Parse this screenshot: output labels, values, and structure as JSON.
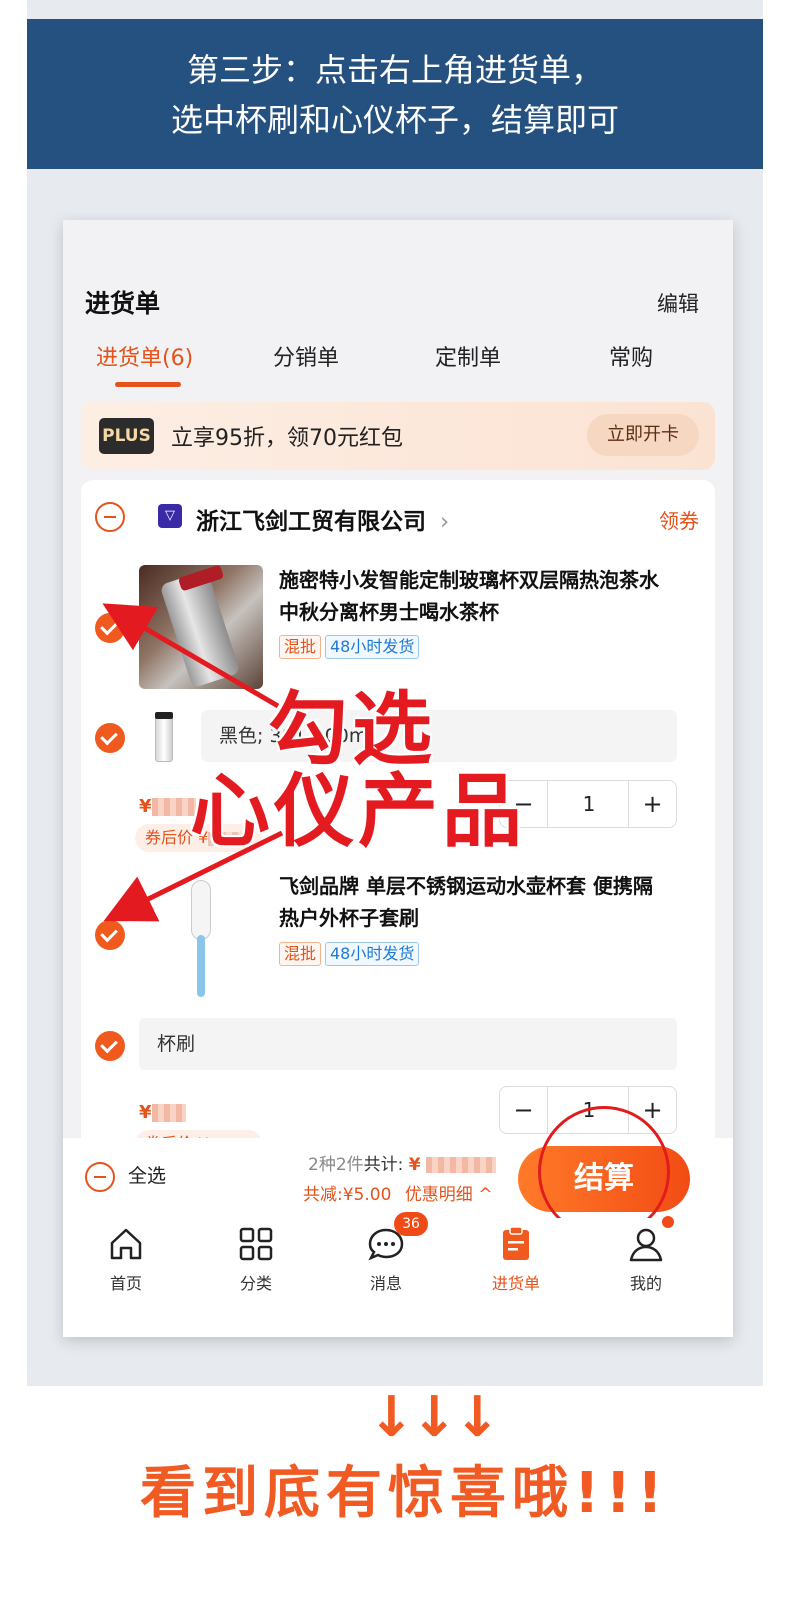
{
  "banner": {
    "line1": "第三步：点击右上角进货单，",
    "line2": "选中杯刷和心仪杯子，结算即可"
  },
  "header": {
    "title": "进货单",
    "edit": "编辑"
  },
  "tabs": [
    {
      "label": "进货单(6)",
      "active": true
    },
    {
      "label": "分销单",
      "active": false
    },
    {
      "label": "定制单",
      "active": false
    },
    {
      "label": "常购",
      "active": false
    }
  ],
  "plus": {
    "badge": "PLUS",
    "text": "立享95折，领70元红包",
    "button": "立即开卡"
  },
  "shop": {
    "name": "浙江飞剑工贸有限公司",
    "chevron": "›",
    "coupon": "领券"
  },
  "items": [
    {
      "title_line1": "施密特小发智能定制玻璃杯双层隔热泡茶水",
      "title_line2": "中秋分离杯男士喝水茶杯",
      "tag1": "混批",
      "tag2": "48小时发货",
      "sku": "黑色; 301-400ml",
      "price_symbol": "¥",
      "after_price_label": "券后价",
      "after_price_symbol": "¥",
      "quantity": "1",
      "minus": "−",
      "plus": "+"
    },
    {
      "title_line1": "飞剑品牌 单层不锈钢运动水壶杯套 便携隔",
      "title_line2": "热户外杯子套刷",
      "tag1": "混批",
      "tag2": "48小时发货",
      "sku": "杯刷",
      "price_symbol": "¥",
      "after_price_label": "券后价",
      "after_price_symbol": "¥",
      "quantity": "1",
      "minus": "−",
      "plus": "+"
    }
  ],
  "checkout": {
    "select_all": "全选",
    "count_text": "2种2件",
    "total_label": "共计:",
    "currency": "¥",
    "discount_label": "共减:",
    "discount_value": "¥5.00",
    "detail_link": "优惠明细",
    "detail_caret": "^",
    "button": "结算"
  },
  "nav": [
    {
      "label": "首页",
      "icon": "home-icon",
      "active": false
    },
    {
      "label": "分类",
      "icon": "grid-icon",
      "active": false
    },
    {
      "label": "消息",
      "icon": "chat-icon",
      "active": false,
      "badge": "36"
    },
    {
      "label": "进货单",
      "icon": "clipboard-icon",
      "active": true
    },
    {
      "label": "我的",
      "icon": "user-icon",
      "active": false
    }
  ],
  "annotation": {
    "line1": "勾选",
    "line2": "心仪产品",
    "color": "#e31b20"
  },
  "footer": {
    "arrows": "↓↓↓",
    "text": "看到底有惊喜哦!!!"
  },
  "colors": {
    "accent": "#e4531b",
    "banner": "#245180",
    "footer": "#f15a22"
  }
}
